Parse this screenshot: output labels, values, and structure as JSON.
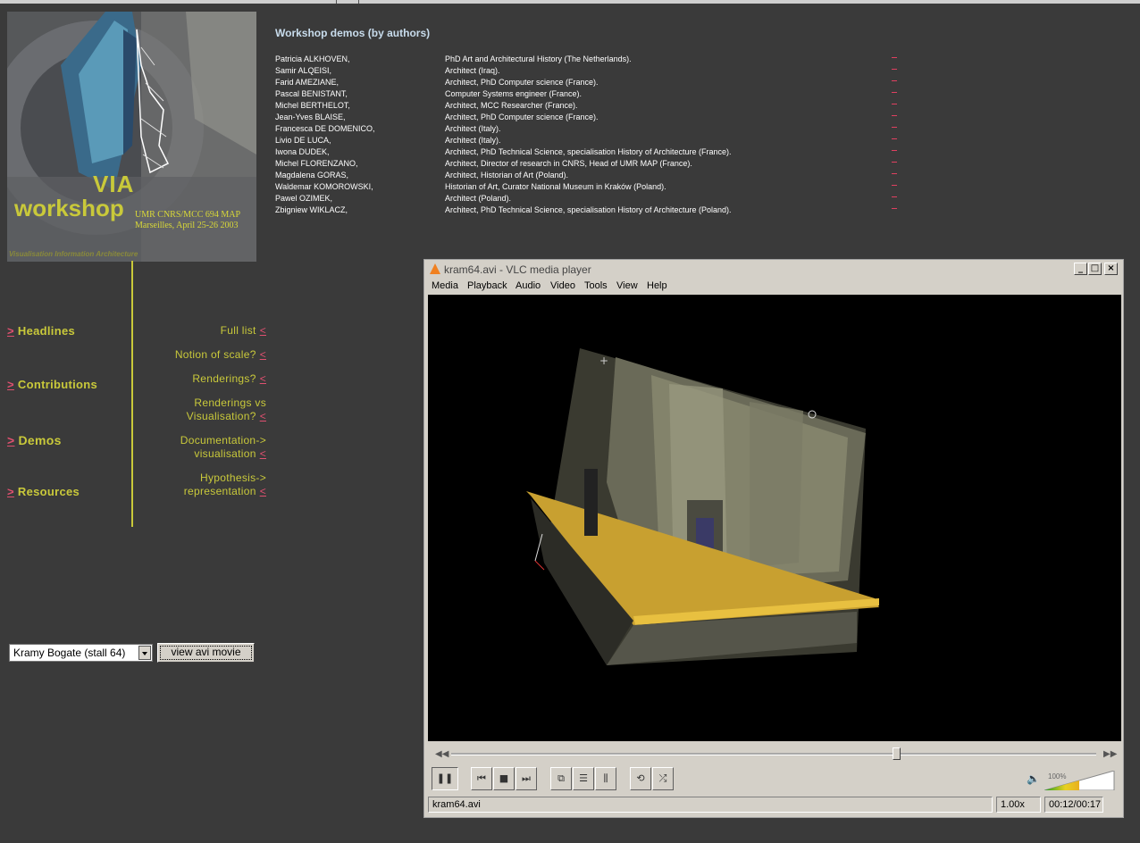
{
  "logo": {
    "title_via": "VIA",
    "title_workshop": "workshop",
    "org": "UMR CNRS/MCC 694 MAP",
    "event": "Marseilles, April 25-26 2003",
    "tagline": "Visualisation Information Architecture"
  },
  "demos": {
    "title": "Workshop demos (by authors)",
    "rows": [
      {
        "name": "Patricia ALKHOVEN,",
        "desc": "PhD Art and Architectural History (The Netherlands)."
      },
      {
        "name": "Samir ALQEISI,",
        "desc": "Architect (Iraq)."
      },
      {
        "name": "Farid AMEZIANE,",
        "desc": "Architect, PhD Computer science (France)."
      },
      {
        "name": "Pascal BENISTANT,",
        "desc": "Computer Systems engineer (France)."
      },
      {
        "name": "Michel BERTHELOT,",
        "desc": "Architect, MCC Researcher (France)."
      },
      {
        "name": "Jean-Yves BLAISE,",
        "desc": "Architect, PhD Computer science (France)."
      },
      {
        "name": "Francesca DE DOMENICO,",
        "desc": "Architect (Italy)."
      },
      {
        "name": "Livio DE LUCA,",
        "desc": "Architect (Italy)."
      },
      {
        "name": "Iwona DUDEK,",
        "desc": "Architect, PhD Technical Science, specialisation History of Architecture (France)."
      },
      {
        "name": "Michel FLORENZANO,",
        "desc": "Architect, Director of research in CNRS, Head of UMR MAP (France)."
      },
      {
        "name": "Magdalena GORAS,",
        "desc": "Architect, Historian of Art (Poland)."
      },
      {
        "name": "Waldemar KOMOROWSKI,",
        "desc": "Historian of Art, Curator National Museum in Kraków (Poland)."
      },
      {
        "name": "Pawel OZIMEK,",
        "desc": "Architect (Poland)."
      },
      {
        "name": "Zbigniew WIKLACZ,",
        "desc": "Architect, PhD Technical Science, specialisation History of Architecture (Poland)."
      }
    ]
  },
  "nav": {
    "arrow_right": ">",
    "arrow_left": "<",
    "headlines": "Headlines",
    "contributions": "Contributions",
    "demos": "Demos",
    "resources": "Resources",
    "sub": [
      {
        "l1": "Full list",
        "l2": ""
      },
      {
        "l1": "Notion of scale?",
        "l2": ""
      },
      {
        "l1": "Renderings?",
        "l2": ""
      },
      {
        "l1": "Renderings vs",
        "l2": "Visualisation?"
      },
      {
        "l1": "Documentation->",
        "l2": "visualisation"
      },
      {
        "l1": "Hypothesis->",
        "l2": "representation"
      }
    ]
  },
  "form": {
    "selected": "Kramy Bogate (stall 64)",
    "button": "view avi movie"
  },
  "vlc": {
    "title": "kram64.avi - VLC media player",
    "menu": [
      "Media",
      "Playback",
      "Audio",
      "Video",
      "Tools",
      "View",
      "Help"
    ],
    "volume": "100%",
    "status_file": "kram64.avi",
    "speed": "1.00x",
    "time": "00:12/00:17",
    "progress": 0.69
  }
}
